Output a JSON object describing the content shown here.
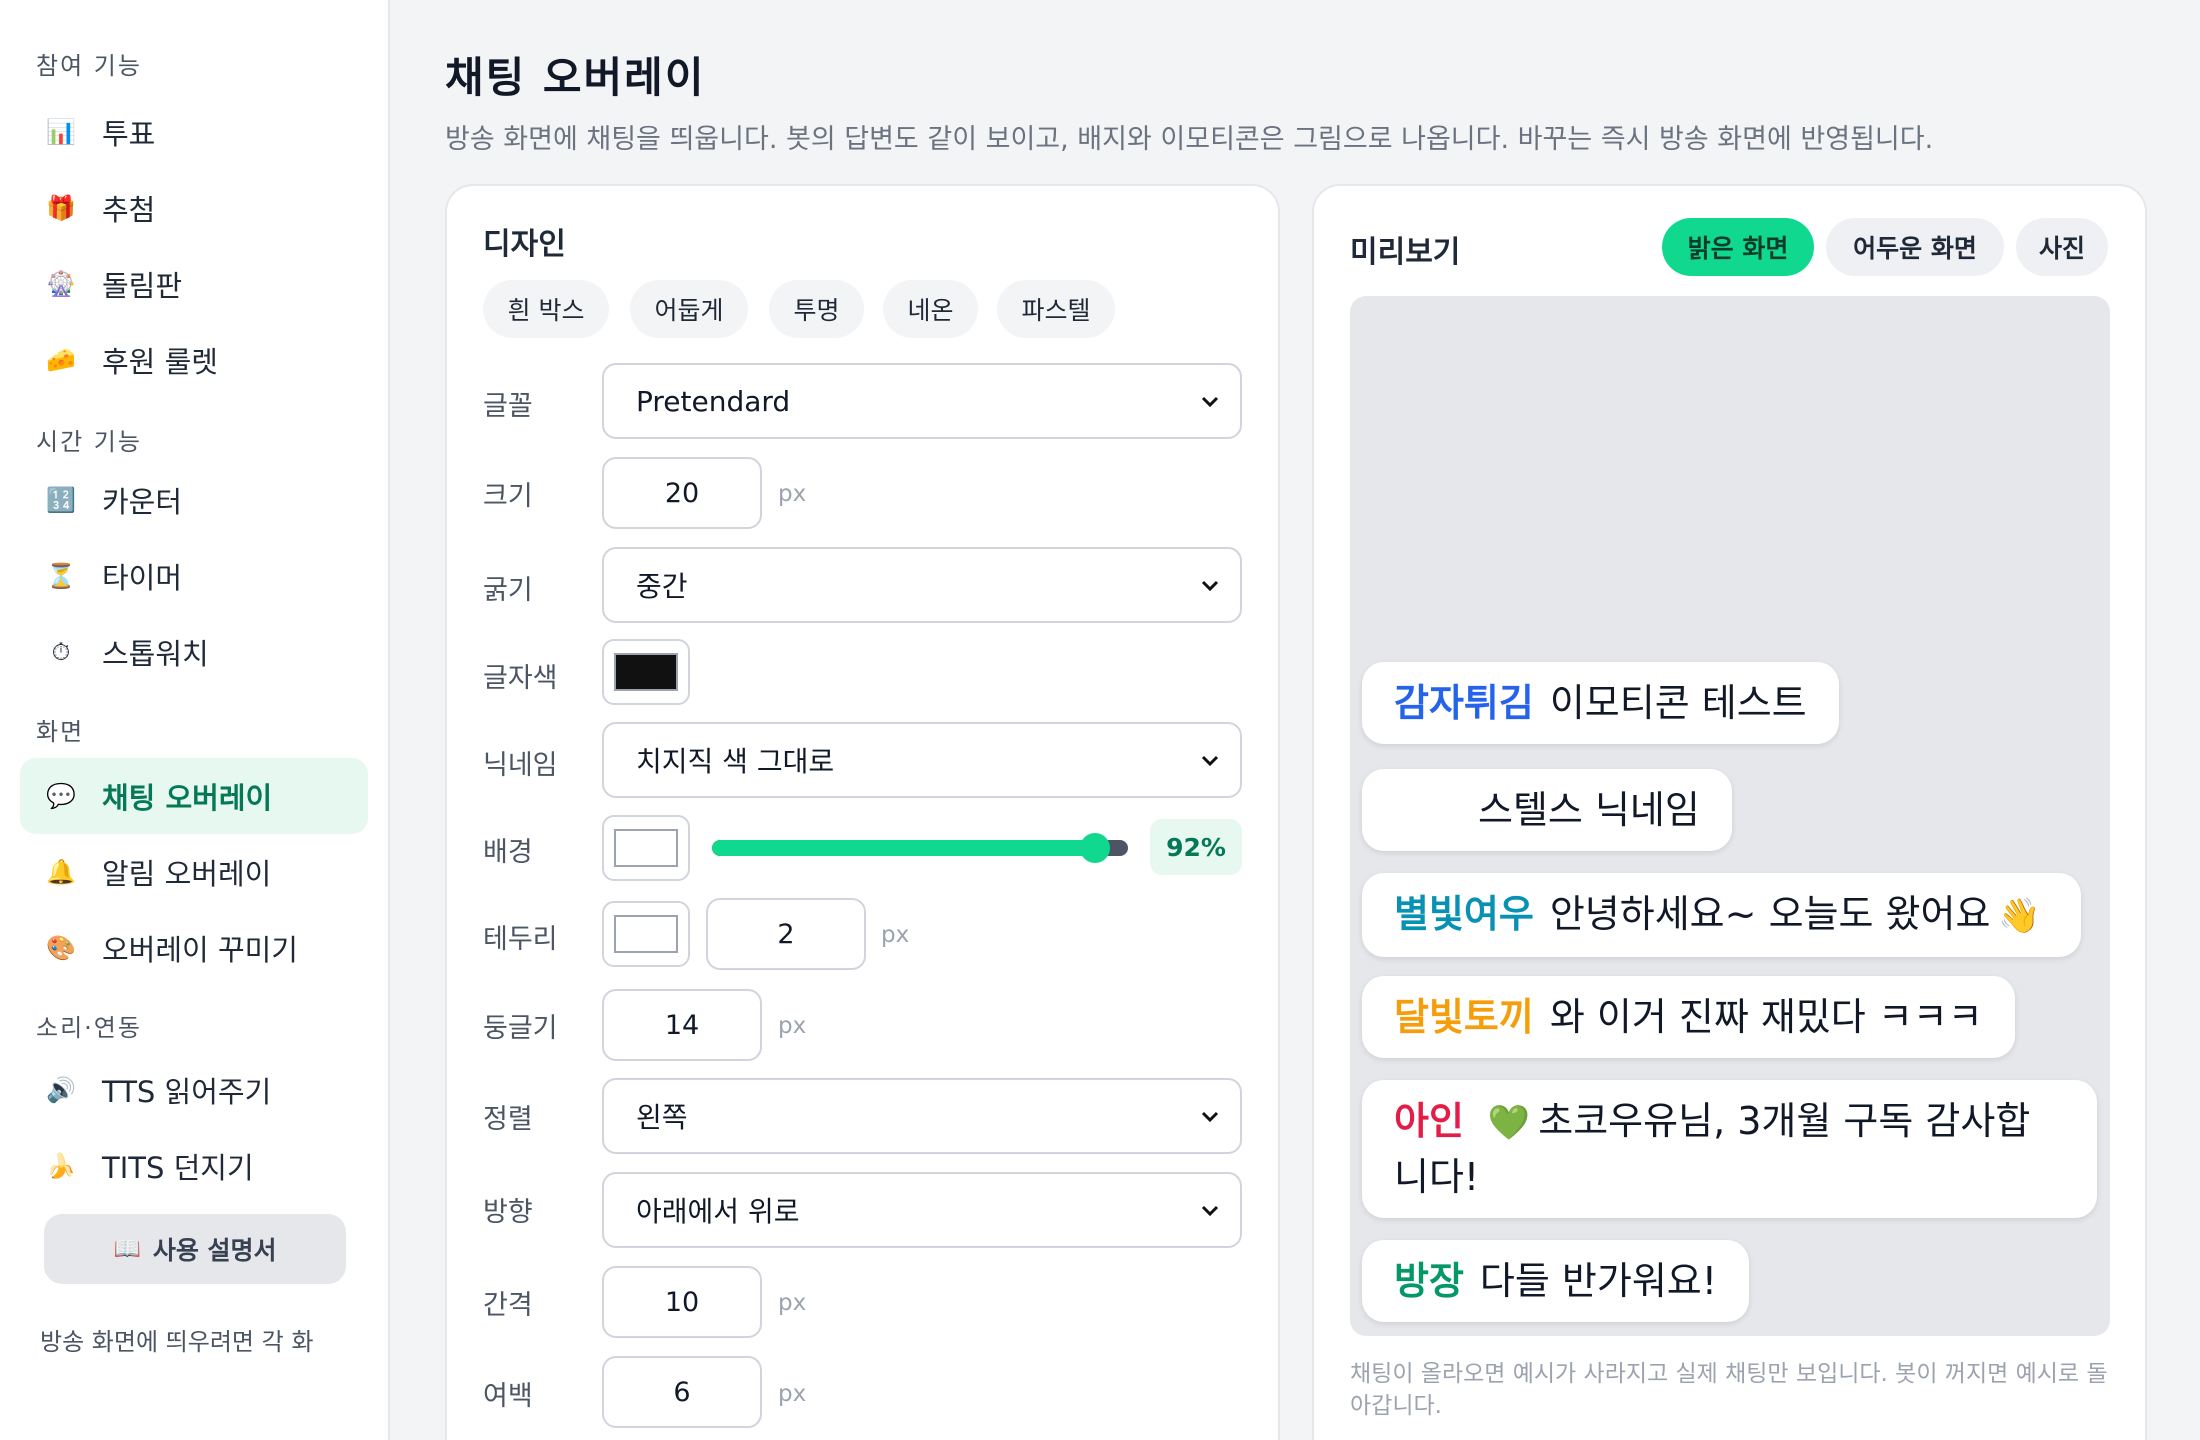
{
  "sidebar": {
    "sections": [
      {
        "title": "참여 기능",
        "items": [
          {
            "label": "투표",
            "icon": "📊"
          },
          {
            "label": "추첨",
            "icon": "🎁"
          },
          {
            "label": "돌림판",
            "icon": "🎡"
          },
          {
            "label": "후원 룰렛",
            "icon": "🧀"
          }
        ]
      },
      {
        "title": "시간 기능",
        "items": [
          {
            "label": "카운터",
            "icon": "🔢"
          },
          {
            "label": "타이머",
            "icon": "⏳"
          },
          {
            "label": "스톱워치",
            "icon": "⏱"
          }
        ]
      },
      {
        "title": "화면",
        "items": [
          {
            "label": "채팅 오버레이",
            "icon": "💬"
          },
          {
            "label": "알림 오버레이",
            "icon": "🔔"
          },
          {
            "label": "오버레이 꾸미기",
            "icon": "🎨"
          }
        ]
      },
      {
        "title": "소리·연동",
        "items": [
          {
            "label": "TTS 읽어주기",
            "icon": "🔊"
          },
          {
            "label": "TITS 던지기",
            "icon": "🍌"
          }
        ]
      }
    ],
    "manual_label": "사용 설명서",
    "manual_icon": "📖",
    "note": "방송 화면에 띄우려면 각 화"
  },
  "page": {
    "title": "채팅 오버레이",
    "description": "방송 화면에 채팅을 띄웁니다. 봇의 답변도 같이 보이고, 배지와 이모티콘은 그림으로 나옵니다. 바꾸는 즉시 방송 화면에 반영됩니다."
  },
  "design": {
    "title": "디자인",
    "presets": [
      "흰 박스",
      "어둡게",
      "투명",
      "네온",
      "파스텔"
    ],
    "font": {
      "label": "글꼴",
      "value": "Pretendard"
    },
    "size": {
      "label": "크기",
      "value": "20",
      "unit": "px"
    },
    "weight": {
      "label": "굵기",
      "value": "중간"
    },
    "text_color": {
      "label": "글자색",
      "color": "#111111"
    },
    "nickname": {
      "label": "닉네임",
      "value": "치지직 색 그대로"
    },
    "background": {
      "label": "배경",
      "color": "#ffffff",
      "opacity_label": "92%",
      "opacity": 0.92
    },
    "border": {
      "label": "테두리",
      "color": "#ffffff",
      "value": "2",
      "unit": "px"
    },
    "radius": {
      "label": "둥글기",
      "value": "14",
      "unit": "px"
    },
    "align": {
      "label": "정렬",
      "value": "왼쪽"
    },
    "direction": {
      "label": "방향",
      "value": "아래에서 위로"
    },
    "gap": {
      "label": "간격",
      "value": "10",
      "unit": "px"
    },
    "padding": {
      "label": "여백",
      "value": "6",
      "unit": "px"
    }
  },
  "preview": {
    "title": "미리보기",
    "tabs": [
      "밝은 화면",
      "어두운 화면",
      "사진"
    ],
    "active_tab": "밝은 화면",
    "messages": [
      {
        "nick": "감자튀김",
        "nick_color": "#2563eb",
        "text": "이모티콘 테스트",
        "emoji": ""
      },
      {
        "nick": "",
        "nick_color": "#111827",
        "text": "스텔스 닉네임",
        "emoji": ""
      },
      {
        "nick": "별빛여우",
        "nick_color": "#0891b2",
        "text": "안녕하세요~ 오늘도 왔어요",
        "emoji": "👋"
      },
      {
        "nick": "달빛토끼",
        "nick_color": "#f59e0b",
        "text": "와 이거 진짜 재밌다 ㅋㅋㅋ",
        "emoji": ""
      },
      {
        "nick": "아인",
        "nick_color": "#e11d48",
        "badge": "💚",
        "text": "초코우유님, 3개월 구독 감사합니다!"
      },
      {
        "nick": "방장",
        "nick_color": "#059669",
        "text": "다들 반가워요!",
        "emoji": ""
      }
    ],
    "note": "채팅이 올라오면 예시가 사라지고 실제 채팅만 보입니다. 봇이 꺼지면 예시로 돌아갑니다."
  },
  "colors": {
    "accent": "#10d98f",
    "accent_dark": "#047857",
    "accent_bg": "#e7f8f0"
  }
}
